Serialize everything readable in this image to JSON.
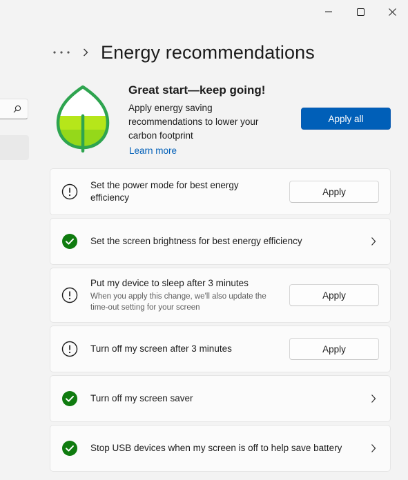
{
  "page": {
    "title": "Energy recommendations"
  },
  "hero": {
    "title": "Great start—keep going!",
    "description": "Apply energy saving recommendations to lower your carbon footprint",
    "learn_more": "Learn more",
    "apply_all": "Apply all"
  },
  "recommendations": [
    {
      "title": "Set the power mode for best energy efficiency",
      "subtitle": "",
      "status": "warning",
      "action": "Apply"
    },
    {
      "title": "Set the screen brightness for best energy efficiency",
      "subtitle": "",
      "status": "done",
      "action": "chevron"
    },
    {
      "title": "Put my device to sleep after 3 minutes",
      "subtitle": "When you apply this change, we'll also update the time-out setting for your screen",
      "status": "warning",
      "action": "Apply"
    },
    {
      "title": "Turn off my screen after 3 minutes",
      "subtitle": "",
      "status": "warning",
      "action": "Apply"
    },
    {
      "title": "Turn off my screen saver",
      "subtitle": "",
      "status": "done",
      "action": "chevron"
    },
    {
      "title": "Stop USB devices when my screen is off to help save battery",
      "subtitle": "",
      "status": "done",
      "action": "chevron"
    }
  ],
  "icons": {
    "window": [
      "minimize-icon",
      "maximize-icon",
      "close-icon"
    ],
    "breadcrumb": [
      "more-icon",
      "chevron-right-icon"
    ],
    "search": "search-icon",
    "hero": "leaf-icon",
    "warning": "info-circle-icon",
    "done": "check-circle-icon"
  },
  "colors": {
    "accent": "#005fb8",
    "success": "#0f7b0f",
    "leaf_green": "#2ea44f",
    "leaf_fill": "#b6e61a",
    "background": "#f3f3f3",
    "card": "#fbfbfb"
  }
}
